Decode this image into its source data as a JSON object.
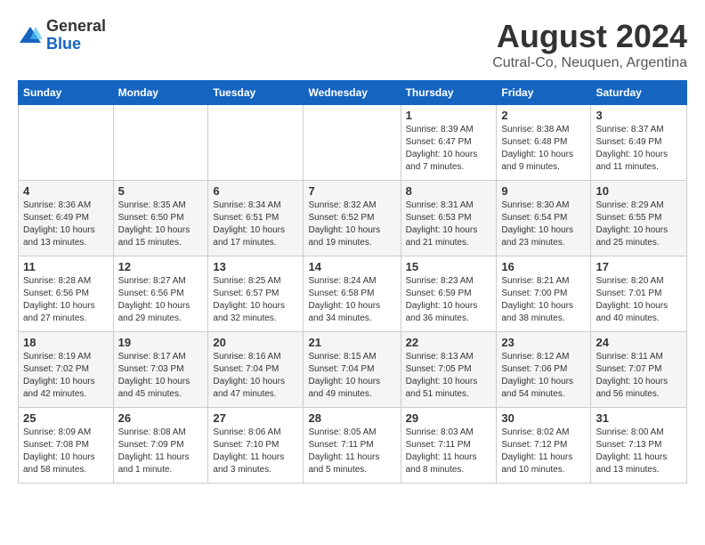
{
  "logo": {
    "general": "General",
    "blue": "Blue"
  },
  "header": {
    "title": "August 2024",
    "subtitle": "Cutral-Co, Neuquen, Argentina"
  },
  "days_of_week": [
    "Sunday",
    "Monday",
    "Tuesday",
    "Wednesday",
    "Thursday",
    "Friday",
    "Saturday"
  ],
  "weeks": [
    [
      {
        "day": "",
        "info": ""
      },
      {
        "day": "",
        "info": ""
      },
      {
        "day": "",
        "info": ""
      },
      {
        "day": "",
        "info": ""
      },
      {
        "day": "1",
        "info": "Sunrise: 8:39 AM\nSunset: 6:47 PM\nDaylight: 10 hours\nand 7 minutes."
      },
      {
        "day": "2",
        "info": "Sunrise: 8:38 AM\nSunset: 6:48 PM\nDaylight: 10 hours\nand 9 minutes."
      },
      {
        "day": "3",
        "info": "Sunrise: 8:37 AM\nSunset: 6:49 PM\nDaylight: 10 hours\nand 11 minutes."
      }
    ],
    [
      {
        "day": "4",
        "info": "Sunrise: 8:36 AM\nSunset: 6:49 PM\nDaylight: 10 hours\nand 13 minutes."
      },
      {
        "day": "5",
        "info": "Sunrise: 8:35 AM\nSunset: 6:50 PM\nDaylight: 10 hours\nand 15 minutes."
      },
      {
        "day": "6",
        "info": "Sunrise: 8:34 AM\nSunset: 6:51 PM\nDaylight: 10 hours\nand 17 minutes."
      },
      {
        "day": "7",
        "info": "Sunrise: 8:32 AM\nSunset: 6:52 PM\nDaylight: 10 hours\nand 19 minutes."
      },
      {
        "day": "8",
        "info": "Sunrise: 8:31 AM\nSunset: 6:53 PM\nDaylight: 10 hours\nand 21 minutes."
      },
      {
        "day": "9",
        "info": "Sunrise: 8:30 AM\nSunset: 6:54 PM\nDaylight: 10 hours\nand 23 minutes."
      },
      {
        "day": "10",
        "info": "Sunrise: 8:29 AM\nSunset: 6:55 PM\nDaylight: 10 hours\nand 25 minutes."
      }
    ],
    [
      {
        "day": "11",
        "info": "Sunrise: 8:28 AM\nSunset: 6:56 PM\nDaylight: 10 hours\nand 27 minutes."
      },
      {
        "day": "12",
        "info": "Sunrise: 8:27 AM\nSunset: 6:56 PM\nDaylight: 10 hours\nand 29 minutes."
      },
      {
        "day": "13",
        "info": "Sunrise: 8:25 AM\nSunset: 6:57 PM\nDaylight: 10 hours\nand 32 minutes."
      },
      {
        "day": "14",
        "info": "Sunrise: 8:24 AM\nSunset: 6:58 PM\nDaylight: 10 hours\nand 34 minutes."
      },
      {
        "day": "15",
        "info": "Sunrise: 8:23 AM\nSunset: 6:59 PM\nDaylight: 10 hours\nand 36 minutes."
      },
      {
        "day": "16",
        "info": "Sunrise: 8:21 AM\nSunset: 7:00 PM\nDaylight: 10 hours\nand 38 minutes."
      },
      {
        "day": "17",
        "info": "Sunrise: 8:20 AM\nSunset: 7:01 PM\nDaylight: 10 hours\nand 40 minutes."
      }
    ],
    [
      {
        "day": "18",
        "info": "Sunrise: 8:19 AM\nSunset: 7:02 PM\nDaylight: 10 hours\nand 42 minutes."
      },
      {
        "day": "19",
        "info": "Sunrise: 8:17 AM\nSunset: 7:03 PM\nDaylight: 10 hours\nand 45 minutes."
      },
      {
        "day": "20",
        "info": "Sunrise: 8:16 AM\nSunset: 7:04 PM\nDaylight: 10 hours\nand 47 minutes."
      },
      {
        "day": "21",
        "info": "Sunrise: 8:15 AM\nSunset: 7:04 PM\nDaylight: 10 hours\nand 49 minutes."
      },
      {
        "day": "22",
        "info": "Sunrise: 8:13 AM\nSunset: 7:05 PM\nDaylight: 10 hours\nand 51 minutes."
      },
      {
        "day": "23",
        "info": "Sunrise: 8:12 AM\nSunset: 7:06 PM\nDaylight: 10 hours\nand 54 minutes."
      },
      {
        "day": "24",
        "info": "Sunrise: 8:11 AM\nSunset: 7:07 PM\nDaylight: 10 hours\nand 56 minutes."
      }
    ],
    [
      {
        "day": "25",
        "info": "Sunrise: 8:09 AM\nSunset: 7:08 PM\nDaylight: 10 hours\nand 58 minutes."
      },
      {
        "day": "26",
        "info": "Sunrise: 8:08 AM\nSunset: 7:09 PM\nDaylight: 11 hours\nand 1 minute."
      },
      {
        "day": "27",
        "info": "Sunrise: 8:06 AM\nSunset: 7:10 PM\nDaylight: 11 hours\nand 3 minutes."
      },
      {
        "day": "28",
        "info": "Sunrise: 8:05 AM\nSunset: 7:11 PM\nDaylight: 11 hours\nand 5 minutes."
      },
      {
        "day": "29",
        "info": "Sunrise: 8:03 AM\nSunset: 7:11 PM\nDaylight: 11 hours\nand 8 minutes."
      },
      {
        "day": "30",
        "info": "Sunrise: 8:02 AM\nSunset: 7:12 PM\nDaylight: 11 hours\nand 10 minutes."
      },
      {
        "day": "31",
        "info": "Sunrise: 8:00 AM\nSunset: 7:13 PM\nDaylight: 11 hours\nand 13 minutes."
      }
    ]
  ]
}
